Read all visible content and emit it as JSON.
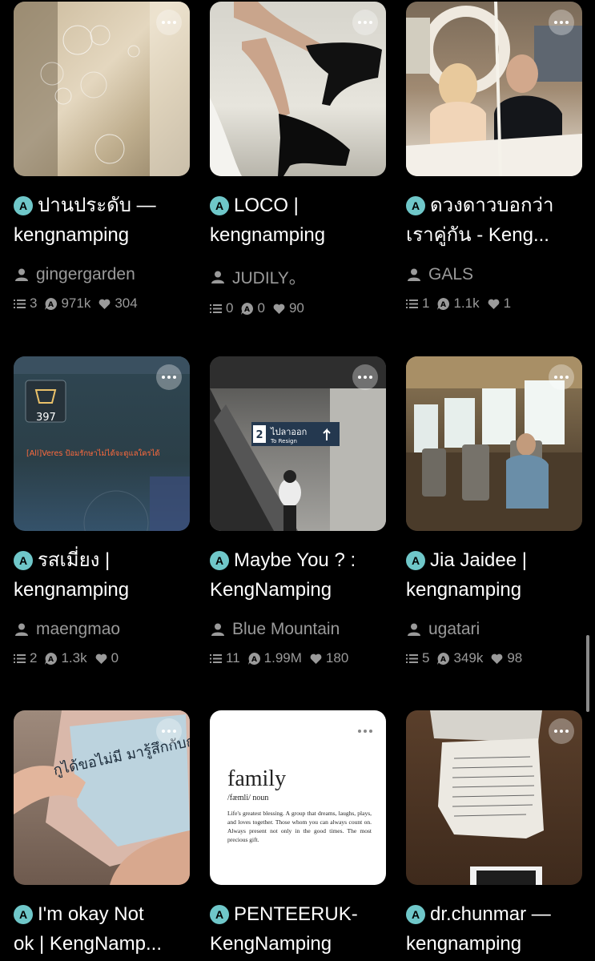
{
  "cards": [
    {
      "title_line1": "ปานประดับ —",
      "title_line2": "kengnamping",
      "author": "gingergarden",
      "parts": "3",
      "reads": "971k",
      "votes": "304"
    },
    {
      "title_line1": "LOCO |",
      "title_line2": "kengnamping",
      "author": "JUDILY。",
      "parts": "0",
      "reads": "0",
      "votes": "90"
    },
    {
      "title_line1": "ดวงดาวบอกว่า",
      "title_line2": "เราคู่กัน - Keng...",
      "author": "GALS",
      "parts": "1",
      "reads": "1.1k",
      "votes": "1"
    },
    {
      "title_line1": "รสเมี่ยง |",
      "title_line2": "kengnamping",
      "author": "maengmao",
      "parts": "2",
      "reads": "1.3k",
      "votes": "0",
      "cover_text": {
        "count": "397",
        "chat": "[All]Veres ป้อมรักษาไม่ได้จะดูแลใครได้"
      }
    },
    {
      "title_line1": "Maybe You ? :",
      "title_line2": "KengNamping",
      "author": "Blue Mountain",
      "parts": "11",
      "reads": "1.99M",
      "votes": "180",
      "cover_text": {
        "sign_num": "2",
        "sign_thai": "ไปลาออก",
        "sign_en": "To Resign"
      }
    },
    {
      "title_line1": "Jia Jaidee |",
      "title_line2": "kengnamping",
      "author": "ugatari",
      "parts": "5",
      "reads": "349k",
      "votes": "98"
    },
    {
      "title_line1": "I'm okay Not",
      "title_line2": "ok | KengNamp...",
      "cover_text": {
        "note": "กูได้ขอไม่มี มารู้สึกกับกูมั้ย"
      }
    },
    {
      "title_line1": "PENTEERUK-",
      "title_line2": "KengNamping",
      "cover_text": {
        "word": "family",
        "phonetic": "/fæmli/ noun",
        "definition": "Life's greatest blessing. A group that dreams, laughs, plays, and loves together. Those whom you can always count on. Always present not only in the good times. The most precious gift."
      }
    },
    {
      "title_line1": "dr.chunmar —",
      "title_line2": "kengnamping"
    }
  ],
  "badge_letter": "A",
  "icons": {
    "more": "more-dots-icon",
    "badge": "a-badge-icon",
    "author": "person-icon",
    "parts": "list-icon",
    "reads": "reads-icon",
    "votes": "heart-icon"
  },
  "colors": {
    "background": "#000000",
    "badge": "#6fc7c9",
    "meta_text": "#9a9a9a"
  }
}
